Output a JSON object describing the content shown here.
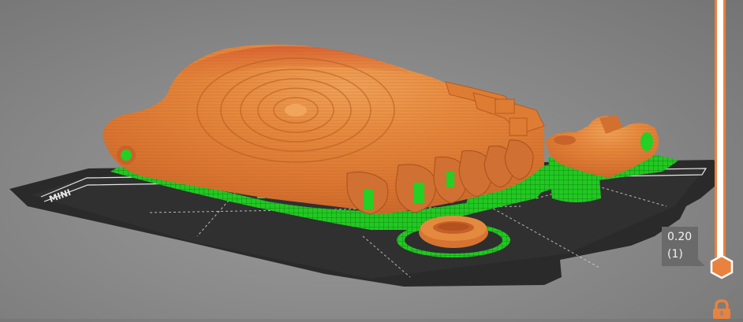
{
  "bed": {
    "label": "MINI"
  },
  "layer_slider": {
    "height": "0.20",
    "layer": "(1)",
    "level": 1
  },
  "colors": {
    "accent": "#e8823e",
    "model": "#e07d33",
    "support": "#1fd31f",
    "bed": "#2b2b2b",
    "tooltip": "#6a6a6a"
  },
  "icons": {
    "lock": "lock-icon",
    "handle": "hexagon-handle-icon"
  }
}
